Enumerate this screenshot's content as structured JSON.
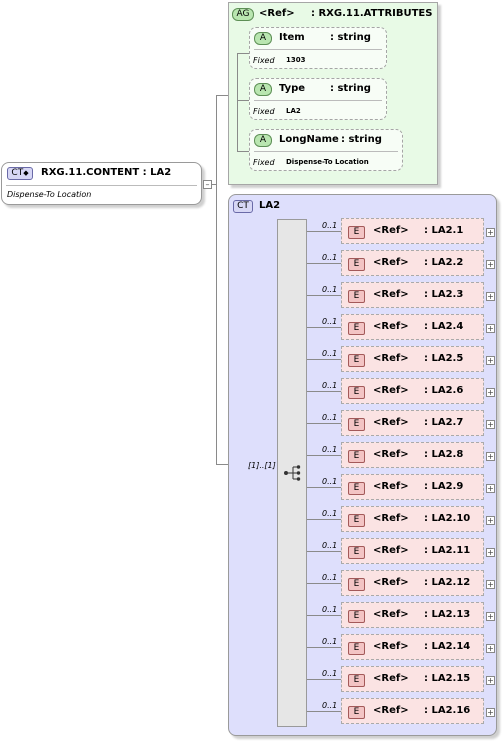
{
  "complex_type": {
    "badge": "CT",
    "name": "RXG.11.CONTENT : LA2",
    "annotation": "Dispense-To Location"
  },
  "attribute_group": {
    "badge": "AG",
    "ref_label": "<Ref>",
    "name": ": RXG.11.ATTRIBUTES",
    "attributes": [
      {
        "badge": "A",
        "name": "Item",
        "type": ": string",
        "fixed_label": "Fixed",
        "fixed_value": "1303"
      },
      {
        "badge": "A",
        "name": "Type",
        "type": ": string",
        "fixed_label": "Fixed",
        "fixed_value": "LA2"
      },
      {
        "badge": "A",
        "name": "LongName",
        "type": ": string",
        "fixed_label": "Fixed",
        "fixed_value": "Dispense-To Location"
      }
    ]
  },
  "la2_type": {
    "badge": "CT",
    "name": "LA2",
    "sequence_occurrence": "[1]..[1]",
    "elements": [
      {
        "badge": "E",
        "ref": "<Ref>",
        "name": ": LA2.1",
        "occurrence": "0..1"
      },
      {
        "badge": "E",
        "ref": "<Ref>",
        "name": ": LA2.2",
        "occurrence": "0..1"
      },
      {
        "badge": "E",
        "ref": "<Ref>",
        "name": ": LA2.3",
        "occurrence": "0..1"
      },
      {
        "badge": "E",
        "ref": "<Ref>",
        "name": ": LA2.4",
        "occurrence": "0..1"
      },
      {
        "badge": "E",
        "ref": "<Ref>",
        "name": ": LA2.5",
        "occurrence": "0..1"
      },
      {
        "badge": "E",
        "ref": "<Ref>",
        "name": ": LA2.6",
        "occurrence": "0..1"
      },
      {
        "badge": "E",
        "ref": "<Ref>",
        "name": ": LA2.7",
        "occurrence": "0..1"
      },
      {
        "badge": "E",
        "ref": "<Ref>",
        "name": ": LA2.8",
        "occurrence": "0..1"
      },
      {
        "badge": "E",
        "ref": "<Ref>",
        "name": ": LA2.9",
        "occurrence": "0..1"
      },
      {
        "badge": "E",
        "ref": "<Ref>",
        "name": ": LA2.10",
        "occurrence": "0..1"
      },
      {
        "badge": "E",
        "ref": "<Ref>",
        "name": ": LA2.11",
        "occurrence": "0..1"
      },
      {
        "badge": "E",
        "ref": "<Ref>",
        "name": ": LA2.12",
        "occurrence": "0..1"
      },
      {
        "badge": "E",
        "ref": "<Ref>",
        "name": ": LA2.13",
        "occurrence": "0..1"
      },
      {
        "badge": "E",
        "ref": "<Ref>",
        "name": ": LA2.14",
        "occurrence": "0..1"
      },
      {
        "badge": "E",
        "ref": "<Ref>",
        "name": ": LA2.15",
        "occurrence": "0..1"
      },
      {
        "badge": "E",
        "ref": "<Ref>",
        "name": ": LA2.16",
        "occurrence": "0..1"
      }
    ]
  },
  "icons": {
    "expand": "plus-box",
    "sequence": "sequence-compositor",
    "collapse": "minus-box"
  },
  "colors": {
    "attribute_group_bg": "#e8fae6",
    "complex_type_bg": "#dedffc",
    "element_bg": "#fbe3e3"
  }
}
